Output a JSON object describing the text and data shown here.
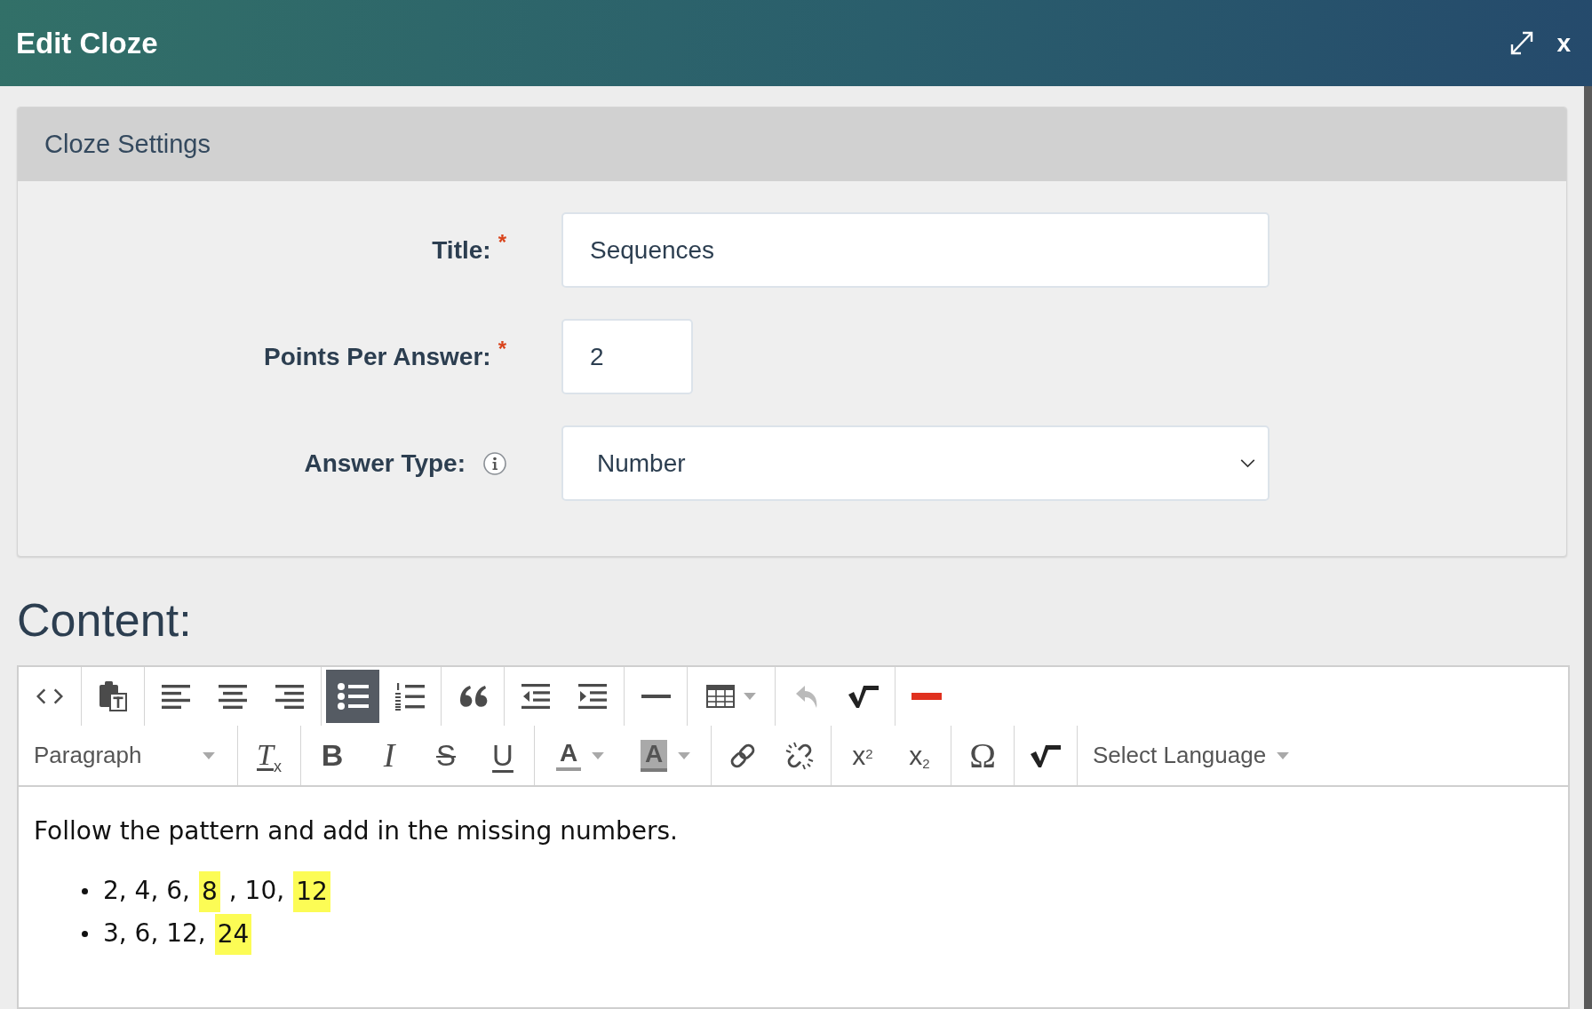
{
  "dialog": {
    "title": "Edit Cloze",
    "close_label": "x"
  },
  "settings": {
    "heading": "Cloze Settings",
    "fields": [
      {
        "kind": "text",
        "label": "Title:",
        "required_mark": "*",
        "value": "Sequences"
      },
      {
        "kind": "number",
        "label": "Points Per Answer:",
        "required_mark": "*",
        "value": "2"
      },
      {
        "kind": "select",
        "label": "Answer Type:",
        "info": true,
        "value": "Number"
      }
    ]
  },
  "content": {
    "heading": "Content:",
    "toolbar": [
      [
        [
          {
            "kind": "source",
            "active": false,
            "disabled": false
          }
        ],
        [
          {
            "kind": "paste",
            "active": false,
            "disabled": false
          }
        ],
        [
          {
            "kind": "align-left",
            "active": false,
            "disabled": false
          },
          {
            "kind": "align-center",
            "active": false,
            "disabled": false
          },
          {
            "kind": "align-right",
            "active": false,
            "disabled": false
          }
        ],
        [
          {
            "kind": "bullets",
            "active": true,
            "disabled": false
          },
          {
            "kind": "numbering",
            "active": false,
            "disabled": false
          }
        ],
        [
          {
            "kind": "quote",
            "active": false,
            "disabled": false
          }
        ],
        [
          {
            "kind": "outdent",
            "active": false,
            "disabled": false
          },
          {
            "kind": "indent",
            "active": false,
            "disabled": false
          }
        ],
        [
          {
            "kind": "rule",
            "active": false,
            "disabled": false
          }
        ],
        [
          {
            "kind": "table",
            "active": false,
            "disabled": false
          }
        ],
        [
          {
            "kind": "undo",
            "active": false,
            "disabled": true
          },
          {
            "kind": "root",
            "active": false,
            "disabled": false
          }
        ],
        [
          {
            "kind": "minus",
            "active": false,
            "disabled": false
          }
        ]
      ],
      [
        [
          {
            "kind": "format",
            "label": "Paragraph"
          }
        ],
        [
          {
            "kind": "clear",
            "glyph": "T",
            "sub": "x",
            "active": false,
            "disabled": false
          }
        ],
        [
          {
            "kind": "bold",
            "glyph": "B",
            "active": false,
            "disabled": false
          },
          {
            "kind": "italic",
            "glyph": "I",
            "active": false,
            "disabled": false
          },
          {
            "kind": "strike",
            "glyph": "S",
            "active": false,
            "disabled": false
          },
          {
            "kind": "underline",
            "glyph": "U",
            "active": false,
            "disabled": false
          }
        ],
        [
          {
            "kind": "forecolor",
            "glyph": "A",
            "active": false,
            "disabled": false
          },
          {
            "kind": "backcolor",
            "glyph": "A",
            "active": false,
            "disabled": false
          }
        ],
        [
          {
            "kind": "link",
            "active": false,
            "disabled": false
          },
          {
            "kind": "unlink",
            "active": false,
            "disabled": false
          }
        ],
        [
          {
            "kind": "superscript",
            "glyph": "x$^{2}$",
            "active": false,
            "disabled": false
          },
          {
            "kind": "subscript",
            "glyph": "x$_{2}$",
            "active": false,
            "disabled": false
          }
        ],
        [
          {
            "kind": "symbol",
            "glyph": "Ω",
            "active": false,
            "disabled": false
          }
        ],
        [
          {
            "kind": "root",
            "active": false,
            "disabled": false
          }
        ],
        [
          {
            "kind": "language",
            "label": "Select Language"
          }
        ]
      ]
    ],
    "body": {
      "paragraph": "Follow the pattern and add in the missing numbers.",
      "bullets": [
        {
          "segments": [
            {
              "kind": "text",
              "text": "2, 4, 6,"
            },
            {
              "kind": "answer",
              "text": "8"
            },
            {
              "kind": "text",
              "text": ", 10,"
            },
            {
              "kind": "answer",
              "text": "12"
            }
          ]
        },
        {
          "segments": [
            {
              "kind": "text",
              "text": "3, 6, 12,"
            },
            {
              "kind": "answer",
              "text": "24"
            }
          ]
        }
      ]
    }
  }
}
